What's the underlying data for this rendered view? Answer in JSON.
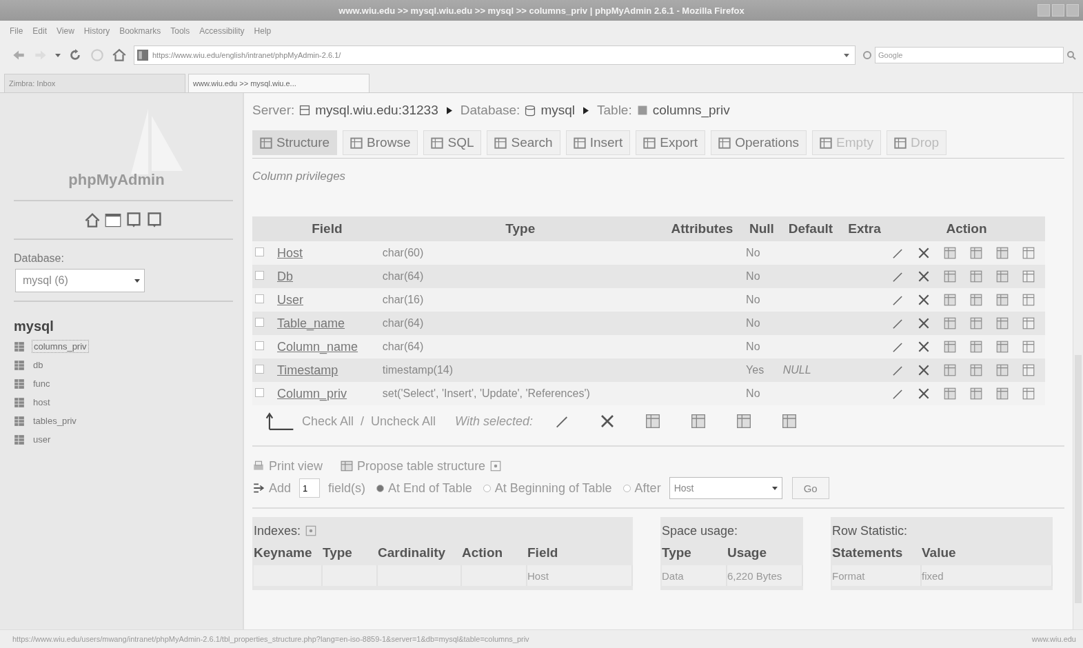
{
  "window": {
    "title": "www.wiu.edu >> mysql.wiu.edu >> mysql >> columns_priv | phpMyAdmin 2.6.1 - Mozilla Firefox"
  },
  "menu": [
    "File",
    "Edit",
    "View",
    "History",
    "Bookmarks",
    "Tools",
    "Accessibility",
    "Help"
  ],
  "address_bar": {
    "value": "https://www.wiu.edu/english/intranet/phpMyAdmin-2.6.1/"
  },
  "search_bar": {
    "placeholder": "Google"
  },
  "browser_tabs": [
    {
      "label": "Zimbra: Inbox",
      "selected": false
    },
    {
      "label": "www.wiu.edu >> mysql.wiu.e...",
      "selected": true
    }
  ],
  "sidebar": {
    "logo": "phpMyAdmin",
    "database_label": "Database:",
    "database_select": "mysql (6)",
    "database_name": "mysql",
    "tables": [
      {
        "name": "columns_priv",
        "selected": true
      },
      {
        "name": "db",
        "selected": false
      },
      {
        "name": "func",
        "selected": false
      },
      {
        "name": "host",
        "selected": false
      },
      {
        "name": "tables_priv",
        "selected": false
      },
      {
        "name": "user",
        "selected": false
      }
    ]
  },
  "breadcrumb": {
    "server_label": "Server:",
    "server": "mysql.wiu.edu:31233",
    "database_label": "Database:",
    "database": "mysql",
    "table_label": "Table:",
    "table": "columns_priv"
  },
  "nav_tabs": [
    {
      "label": "Structure",
      "selected": true,
      "disabled": false
    },
    {
      "label": "Browse",
      "selected": false,
      "disabled": false
    },
    {
      "label": "SQL",
      "selected": false,
      "disabled": false
    },
    {
      "label": "Search",
      "selected": false,
      "disabled": false
    },
    {
      "label": "Insert",
      "selected": false,
      "disabled": false
    },
    {
      "label": "Export",
      "selected": false,
      "disabled": false
    },
    {
      "label": "Operations",
      "selected": false,
      "disabled": false
    },
    {
      "label": "Empty",
      "selected": false,
      "disabled": true
    },
    {
      "label": "Drop",
      "selected": false,
      "disabled": true
    }
  ],
  "table_comment": "Column privileges",
  "structure_table": {
    "columns": [
      "Field",
      "Type",
      "Attributes",
      "Null",
      "Default",
      "Extra",
      "Action"
    ],
    "rows": [
      {
        "field": "Host",
        "type": "char(60)",
        "null": "No",
        "default": "",
        "checked": false
      },
      {
        "field": "Db",
        "type": "char(64)",
        "null": "No",
        "default": "",
        "checked": false
      },
      {
        "field": "User",
        "type": "char(16)",
        "null": "No",
        "default": "",
        "checked": false
      },
      {
        "field": "Table_name",
        "type": "char(64)",
        "null": "No",
        "default": "",
        "checked": false
      },
      {
        "field": "Column_name",
        "type": "char(64)",
        "null": "No",
        "default": "",
        "checked": false
      },
      {
        "field": "Timestamp",
        "type": "timestamp(14)",
        "null": "Yes",
        "default": "NULL",
        "checked": false
      },
      {
        "field": "Column_priv",
        "type": "set('Select', 'Insert', 'Update', 'References')",
        "null": "No",
        "default": "",
        "checked": false
      }
    ]
  },
  "bulk_actions": {
    "check_all": "Check All",
    "separator": "/",
    "uncheck_all": "Uncheck All",
    "with_selected": "With selected:"
  },
  "links": {
    "print_view": "Print view",
    "propose": "Propose table structure"
  },
  "add_fields": {
    "add": "Add",
    "count": "1",
    "fields_label": "field(s)",
    "positions": [
      {
        "label": "At End of Table",
        "selected": true
      },
      {
        "label": "At Beginning of Table",
        "selected": false
      },
      {
        "label": "After",
        "selected": false
      }
    ],
    "after_select": "Host",
    "go": "Go"
  },
  "indexes": {
    "title": "Indexes:",
    "columns": [
      "Keyname",
      "Type",
      "Cardinality",
      "Action",
      "Field"
    ],
    "rows": [
      [
        "",
        "",
        "",
        "",
        "Host"
      ]
    ]
  },
  "space_usage": {
    "title": "Space usage:",
    "columns": [
      "Type",
      "Usage"
    ],
    "rows": [
      [
        "Data",
        "6,220 Bytes"
      ]
    ]
  },
  "row_statistic": {
    "title": "Row Statistic:",
    "columns": [
      "Statements",
      "Value"
    ],
    "rows": [
      [
        "Format",
        "fixed"
      ]
    ]
  },
  "status_bar": {
    "url": "https://www.wiu.edu/users/mwang/intranet/phpMyAdmin-2.6.1/tbl_properties_structure.php?lang=en-iso-8859-1&server=1&db=mysql&table=columns_priv",
    "host": "www.wiu.edu"
  }
}
